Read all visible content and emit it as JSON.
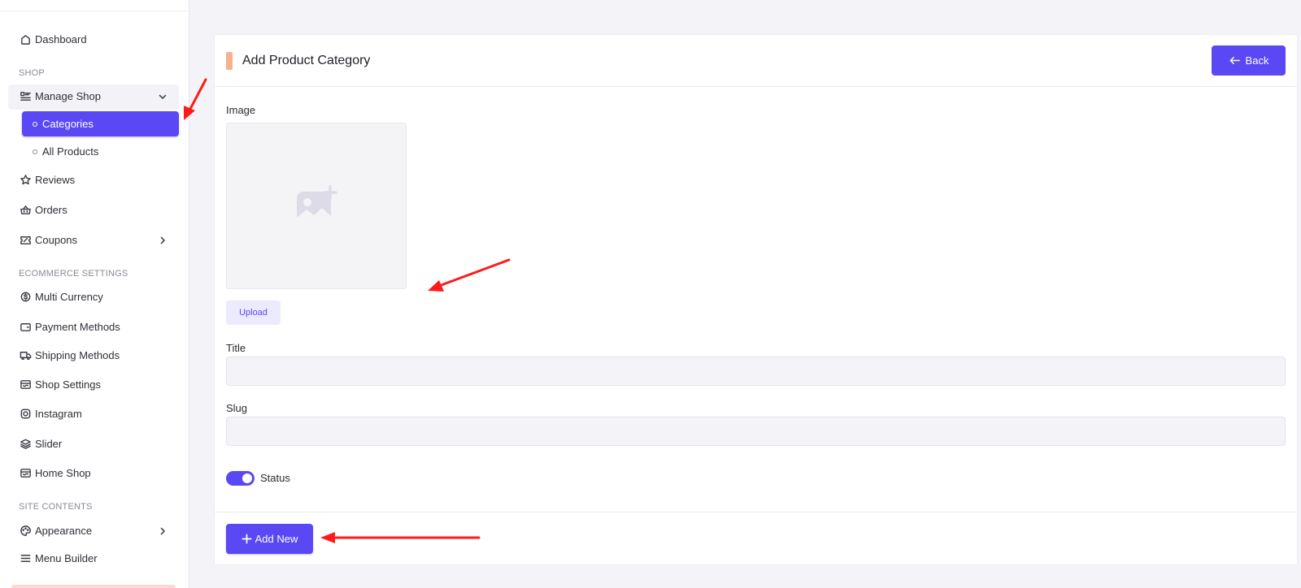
{
  "sidebar": {
    "dashboard": "Dashboard",
    "section_shop": "SHOP",
    "manage_shop": "Manage Shop",
    "categories": "Categories",
    "all_products": "All Products",
    "reviews": "Reviews",
    "orders": "Orders",
    "coupons": "Coupons",
    "section_ecommerce": "ECOMMERCE SETTINGS",
    "multi_currency": "Multi Currency",
    "payment_methods": "Payment Methods",
    "shipping_methods": "Shipping Methods",
    "shop_settings": "Shop Settings",
    "instagram": "Instagram",
    "slider": "Slider",
    "home_shop": "Home Shop",
    "section_site": "SITE CONTENTS",
    "appearance": "Appearance",
    "menu_builder": "Menu Builder"
  },
  "header": {
    "title": "Add Product Category",
    "back_label": "Back"
  },
  "form": {
    "image_label": "Image",
    "upload_label": "Upload",
    "title_label": "Title",
    "title_value": "",
    "slug_label": "Slug",
    "slug_value": "",
    "status_label": "Status",
    "status_on": true,
    "submit_label": "Add New"
  },
  "colors": {
    "primary": "#5a48f5",
    "accent": "#f6b28c",
    "annotation": "#ff1a1a"
  }
}
